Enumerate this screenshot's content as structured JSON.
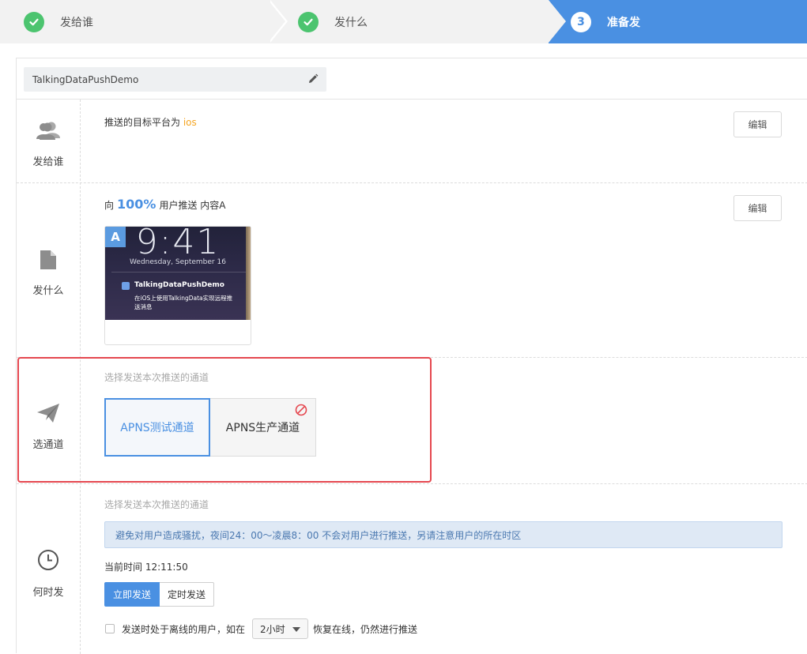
{
  "stepper": {
    "steps": [
      {
        "label": "发给谁",
        "state": "done"
      },
      {
        "label": "发什么",
        "state": "done"
      },
      {
        "label": "准备发",
        "number": "3",
        "state": "active"
      }
    ],
    "colors": {
      "done": "#4cc46f",
      "active": "#4a90e2"
    }
  },
  "app": {
    "name": "TalkingDataPushDemo"
  },
  "sections": {
    "who": {
      "label": "发给谁",
      "text_prefix": "推送的目标平台为",
      "platform": "ios",
      "edit_label": "编辑"
    },
    "what": {
      "label": "发什么",
      "text_prefix": "向",
      "percent": "100%",
      "text_suffix": "用户推送 内容A",
      "edit_label": "编辑",
      "preview": {
        "badge": "A",
        "time": "9:41",
        "date": "Wednesday, September 16",
        "notif_title": "TalkingDataPushDemo",
        "notif_body": "在iOS上使用TalkingData实现远程推送消息"
      }
    },
    "channel": {
      "label": "选通道",
      "hint": "选择发送本次推送的通道",
      "options": [
        {
          "label": "APNS测试通道",
          "selected": true
        },
        {
          "label": "APNS生产通道",
          "selected": false,
          "disabled": true
        }
      ]
    },
    "when": {
      "label": "何时发",
      "hint": "选择发送本次推送的通道",
      "notice": "避免对用户造成骚扰，夜间24：00～凌晨8：00 不会对用户进行推送，另请注意用户的所在时区",
      "current_time_label": "当前时间",
      "current_time": "12:11:50",
      "send_now_label": "立即发送",
      "send_scheduled_label": "定时发送",
      "offline_prefix": "发送时处于离线的用户，如在",
      "offline_select_value": "2小时",
      "offline_suffix": "恢复在线，仍然进行推送"
    }
  },
  "icons": {
    "who": "users-icon",
    "what": "document-icon",
    "channel": "paper-plane-icon",
    "when": "clock-icon",
    "edit_app": "pencil-icon",
    "disabled": "ban-icon"
  }
}
